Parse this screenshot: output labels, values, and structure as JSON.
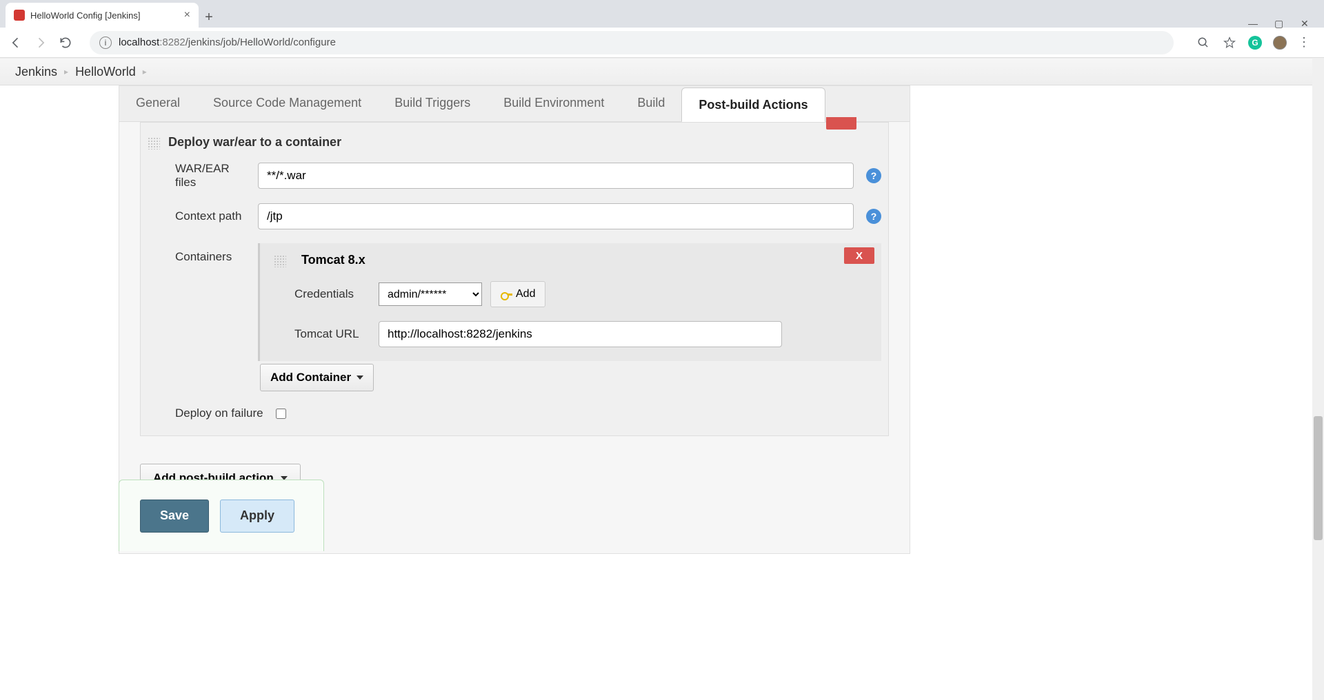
{
  "browser": {
    "tab_title": "HelloWorld Config [Jenkins]",
    "url_host": "localhost",
    "url_port": ":8282",
    "url_path": "/jenkins/job/HelloWorld/configure"
  },
  "breadcrumb": {
    "items": [
      "Jenkins",
      "HelloWorld"
    ]
  },
  "tabs": {
    "general": "General",
    "scm": "Source Code Management",
    "triggers": "Build Triggers",
    "environment": "Build Environment",
    "build": "Build",
    "postbuild": "Post-build Actions"
  },
  "deploy": {
    "section_title": "Deploy war/ear to a container",
    "war_label": "WAR/EAR files",
    "war_value": "**/*.war",
    "context_label": "Context path",
    "context_value": "/jtp",
    "containers_label": "Containers",
    "container_title": "Tomcat 8.x",
    "credentials_label": "Credentials",
    "credentials_value": "admin/******",
    "add_btn": "Add",
    "tomcat_url_label": "Tomcat URL",
    "tomcat_url_value": "http://localhost:8282/jenkins",
    "add_container": "Add Container",
    "deploy_on_failure": "Deploy on failure",
    "remove_label": "X"
  },
  "add_post_action": "Add post-build action",
  "buttons": {
    "save": "Save",
    "apply": "Apply"
  }
}
